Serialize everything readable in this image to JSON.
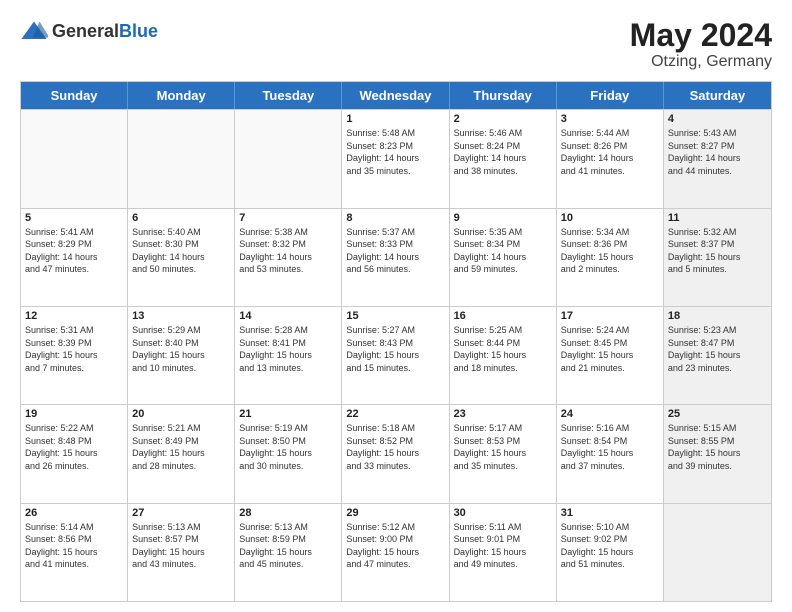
{
  "header": {
    "logo_general": "General",
    "logo_blue": "Blue",
    "month_year": "May 2024",
    "location": "Otzing, Germany"
  },
  "calendar": {
    "days": [
      "Sunday",
      "Monday",
      "Tuesday",
      "Wednesday",
      "Thursday",
      "Friday",
      "Saturday"
    ],
    "rows": [
      [
        {
          "day": "",
          "lines": [],
          "empty": true
        },
        {
          "day": "",
          "lines": [],
          "empty": true
        },
        {
          "day": "",
          "lines": [],
          "empty": true
        },
        {
          "day": "1",
          "lines": [
            "Sunrise: 5:48 AM",
            "Sunset: 8:23 PM",
            "Daylight: 14 hours",
            "and 35 minutes."
          ],
          "empty": false
        },
        {
          "day": "2",
          "lines": [
            "Sunrise: 5:46 AM",
            "Sunset: 8:24 PM",
            "Daylight: 14 hours",
            "and 38 minutes."
          ],
          "empty": false
        },
        {
          "day": "3",
          "lines": [
            "Sunrise: 5:44 AM",
            "Sunset: 8:26 PM",
            "Daylight: 14 hours",
            "and 41 minutes."
          ],
          "empty": false
        },
        {
          "day": "4",
          "lines": [
            "Sunrise: 5:43 AM",
            "Sunset: 8:27 PM",
            "Daylight: 14 hours",
            "and 44 minutes."
          ],
          "empty": false,
          "shaded": true
        }
      ],
      [
        {
          "day": "5",
          "lines": [
            "Sunrise: 5:41 AM",
            "Sunset: 8:29 PM",
            "Daylight: 14 hours",
            "and 47 minutes."
          ],
          "empty": false
        },
        {
          "day": "6",
          "lines": [
            "Sunrise: 5:40 AM",
            "Sunset: 8:30 PM",
            "Daylight: 14 hours",
            "and 50 minutes."
          ],
          "empty": false
        },
        {
          "day": "7",
          "lines": [
            "Sunrise: 5:38 AM",
            "Sunset: 8:32 PM",
            "Daylight: 14 hours",
            "and 53 minutes."
          ],
          "empty": false
        },
        {
          "day": "8",
          "lines": [
            "Sunrise: 5:37 AM",
            "Sunset: 8:33 PM",
            "Daylight: 14 hours",
            "and 56 minutes."
          ],
          "empty": false
        },
        {
          "day": "9",
          "lines": [
            "Sunrise: 5:35 AM",
            "Sunset: 8:34 PM",
            "Daylight: 14 hours",
            "and 59 minutes."
          ],
          "empty": false
        },
        {
          "day": "10",
          "lines": [
            "Sunrise: 5:34 AM",
            "Sunset: 8:36 PM",
            "Daylight: 15 hours",
            "and 2 minutes."
          ],
          "empty": false
        },
        {
          "day": "11",
          "lines": [
            "Sunrise: 5:32 AM",
            "Sunset: 8:37 PM",
            "Daylight: 15 hours",
            "and 5 minutes."
          ],
          "empty": false,
          "shaded": true
        }
      ],
      [
        {
          "day": "12",
          "lines": [
            "Sunrise: 5:31 AM",
            "Sunset: 8:39 PM",
            "Daylight: 15 hours",
            "and 7 minutes."
          ],
          "empty": false
        },
        {
          "day": "13",
          "lines": [
            "Sunrise: 5:29 AM",
            "Sunset: 8:40 PM",
            "Daylight: 15 hours",
            "and 10 minutes."
          ],
          "empty": false
        },
        {
          "day": "14",
          "lines": [
            "Sunrise: 5:28 AM",
            "Sunset: 8:41 PM",
            "Daylight: 15 hours",
            "and 13 minutes."
          ],
          "empty": false
        },
        {
          "day": "15",
          "lines": [
            "Sunrise: 5:27 AM",
            "Sunset: 8:43 PM",
            "Daylight: 15 hours",
            "and 15 minutes."
          ],
          "empty": false
        },
        {
          "day": "16",
          "lines": [
            "Sunrise: 5:25 AM",
            "Sunset: 8:44 PM",
            "Daylight: 15 hours",
            "and 18 minutes."
          ],
          "empty": false
        },
        {
          "day": "17",
          "lines": [
            "Sunrise: 5:24 AM",
            "Sunset: 8:45 PM",
            "Daylight: 15 hours",
            "and 21 minutes."
          ],
          "empty": false
        },
        {
          "day": "18",
          "lines": [
            "Sunrise: 5:23 AM",
            "Sunset: 8:47 PM",
            "Daylight: 15 hours",
            "and 23 minutes."
          ],
          "empty": false,
          "shaded": true
        }
      ],
      [
        {
          "day": "19",
          "lines": [
            "Sunrise: 5:22 AM",
            "Sunset: 8:48 PM",
            "Daylight: 15 hours",
            "and 26 minutes."
          ],
          "empty": false
        },
        {
          "day": "20",
          "lines": [
            "Sunrise: 5:21 AM",
            "Sunset: 8:49 PM",
            "Daylight: 15 hours",
            "and 28 minutes."
          ],
          "empty": false
        },
        {
          "day": "21",
          "lines": [
            "Sunrise: 5:19 AM",
            "Sunset: 8:50 PM",
            "Daylight: 15 hours",
            "and 30 minutes."
          ],
          "empty": false
        },
        {
          "day": "22",
          "lines": [
            "Sunrise: 5:18 AM",
            "Sunset: 8:52 PM",
            "Daylight: 15 hours",
            "and 33 minutes."
          ],
          "empty": false
        },
        {
          "day": "23",
          "lines": [
            "Sunrise: 5:17 AM",
            "Sunset: 8:53 PM",
            "Daylight: 15 hours",
            "and 35 minutes."
          ],
          "empty": false
        },
        {
          "day": "24",
          "lines": [
            "Sunrise: 5:16 AM",
            "Sunset: 8:54 PM",
            "Daylight: 15 hours",
            "and 37 minutes."
          ],
          "empty": false
        },
        {
          "day": "25",
          "lines": [
            "Sunrise: 5:15 AM",
            "Sunset: 8:55 PM",
            "Daylight: 15 hours",
            "and 39 minutes."
          ],
          "empty": false,
          "shaded": true
        }
      ],
      [
        {
          "day": "26",
          "lines": [
            "Sunrise: 5:14 AM",
            "Sunset: 8:56 PM",
            "Daylight: 15 hours",
            "and 41 minutes."
          ],
          "empty": false
        },
        {
          "day": "27",
          "lines": [
            "Sunrise: 5:13 AM",
            "Sunset: 8:57 PM",
            "Daylight: 15 hours",
            "and 43 minutes."
          ],
          "empty": false
        },
        {
          "day": "28",
          "lines": [
            "Sunrise: 5:13 AM",
            "Sunset: 8:59 PM",
            "Daylight: 15 hours",
            "and 45 minutes."
          ],
          "empty": false
        },
        {
          "day": "29",
          "lines": [
            "Sunrise: 5:12 AM",
            "Sunset: 9:00 PM",
            "Daylight: 15 hours",
            "and 47 minutes."
          ],
          "empty": false
        },
        {
          "day": "30",
          "lines": [
            "Sunrise: 5:11 AM",
            "Sunset: 9:01 PM",
            "Daylight: 15 hours",
            "and 49 minutes."
          ],
          "empty": false
        },
        {
          "day": "31",
          "lines": [
            "Sunrise: 5:10 AM",
            "Sunset: 9:02 PM",
            "Daylight: 15 hours",
            "and 51 minutes."
          ],
          "empty": false
        },
        {
          "day": "",
          "lines": [],
          "empty": true,
          "shaded": true
        }
      ]
    ]
  }
}
